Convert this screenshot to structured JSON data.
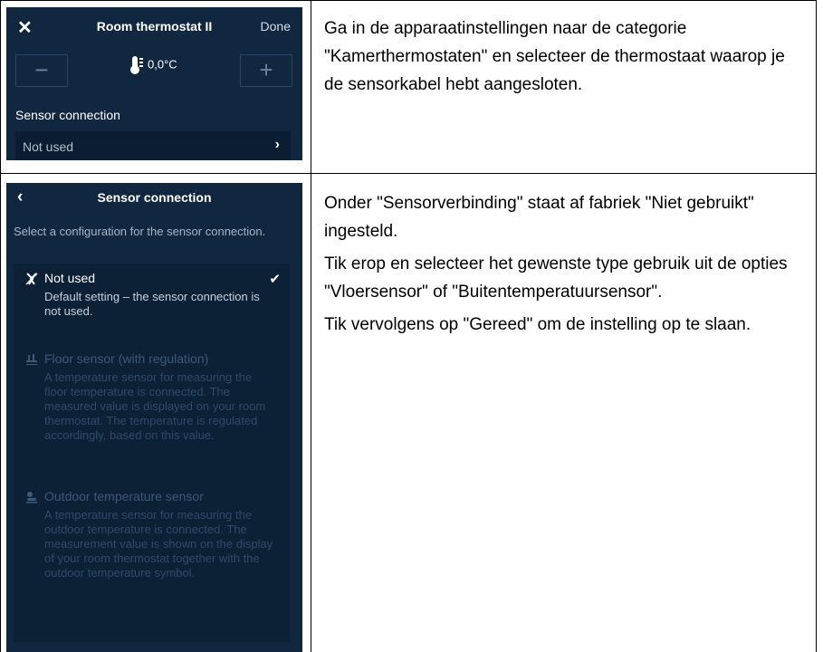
{
  "screen1": {
    "close_glyph": "✕",
    "title": "Room thermostat II",
    "done_label": "Done",
    "minus_label": "−",
    "plus_label": "+",
    "temperature": "0,0°C",
    "section_label": "Sensor connection",
    "current_value": "Not used",
    "chevron": "›"
  },
  "screen2": {
    "back_glyph": "‹",
    "title": "Sensor connection",
    "description": "Select a configuration for the sensor connection.",
    "options": [
      {
        "title": "Not used",
        "description": "Default setting – the sensor connection is not used.",
        "icon": "no-sensor-icon",
        "selected": true,
        "check": "✔"
      },
      {
        "title": "Floor sensor (with regulation)",
        "description": "A temperature sensor for measuring the floor temperature is connected. The measured value is displayed on your room thermostat. The temperature is regulated accordingly, based on this value.",
        "icon": "floor-sensor-icon",
        "selected": false
      },
      {
        "title": "Outdoor temperature sensor",
        "description": "A temperature sensor for measuring the outdoor temperature is connected. The measurement value is shown on the display of your room thermostat together with the outdoor temperature symbol.",
        "icon": "outdoor-sensor-icon",
        "selected": false
      }
    ]
  },
  "instructions": {
    "step1": "Ga in de apparaatinstellingen naar de categorie \"Kamerthermostaten\" en selecteer de thermostaat waarop je de sensorkabel hebt aangesloten.",
    "step2_p1": "Onder \"Sensorverbinding\" staat af fabriek \"Niet gebruikt\" ingesteld.",
    "step2_p2": "Tik erop en selecteer het gewenste type gebruik uit de opties \"Vloersensor\" of \"Buitentemperatuursensor\".",
    "step2_p3": "Tik vervolgens op \"Gereed\" om de instelling op te slaan."
  },
  "colors": {
    "screen_bg": "#11273f",
    "row_bg": "#0a1d33",
    "dim_text": "#3d5978"
  }
}
